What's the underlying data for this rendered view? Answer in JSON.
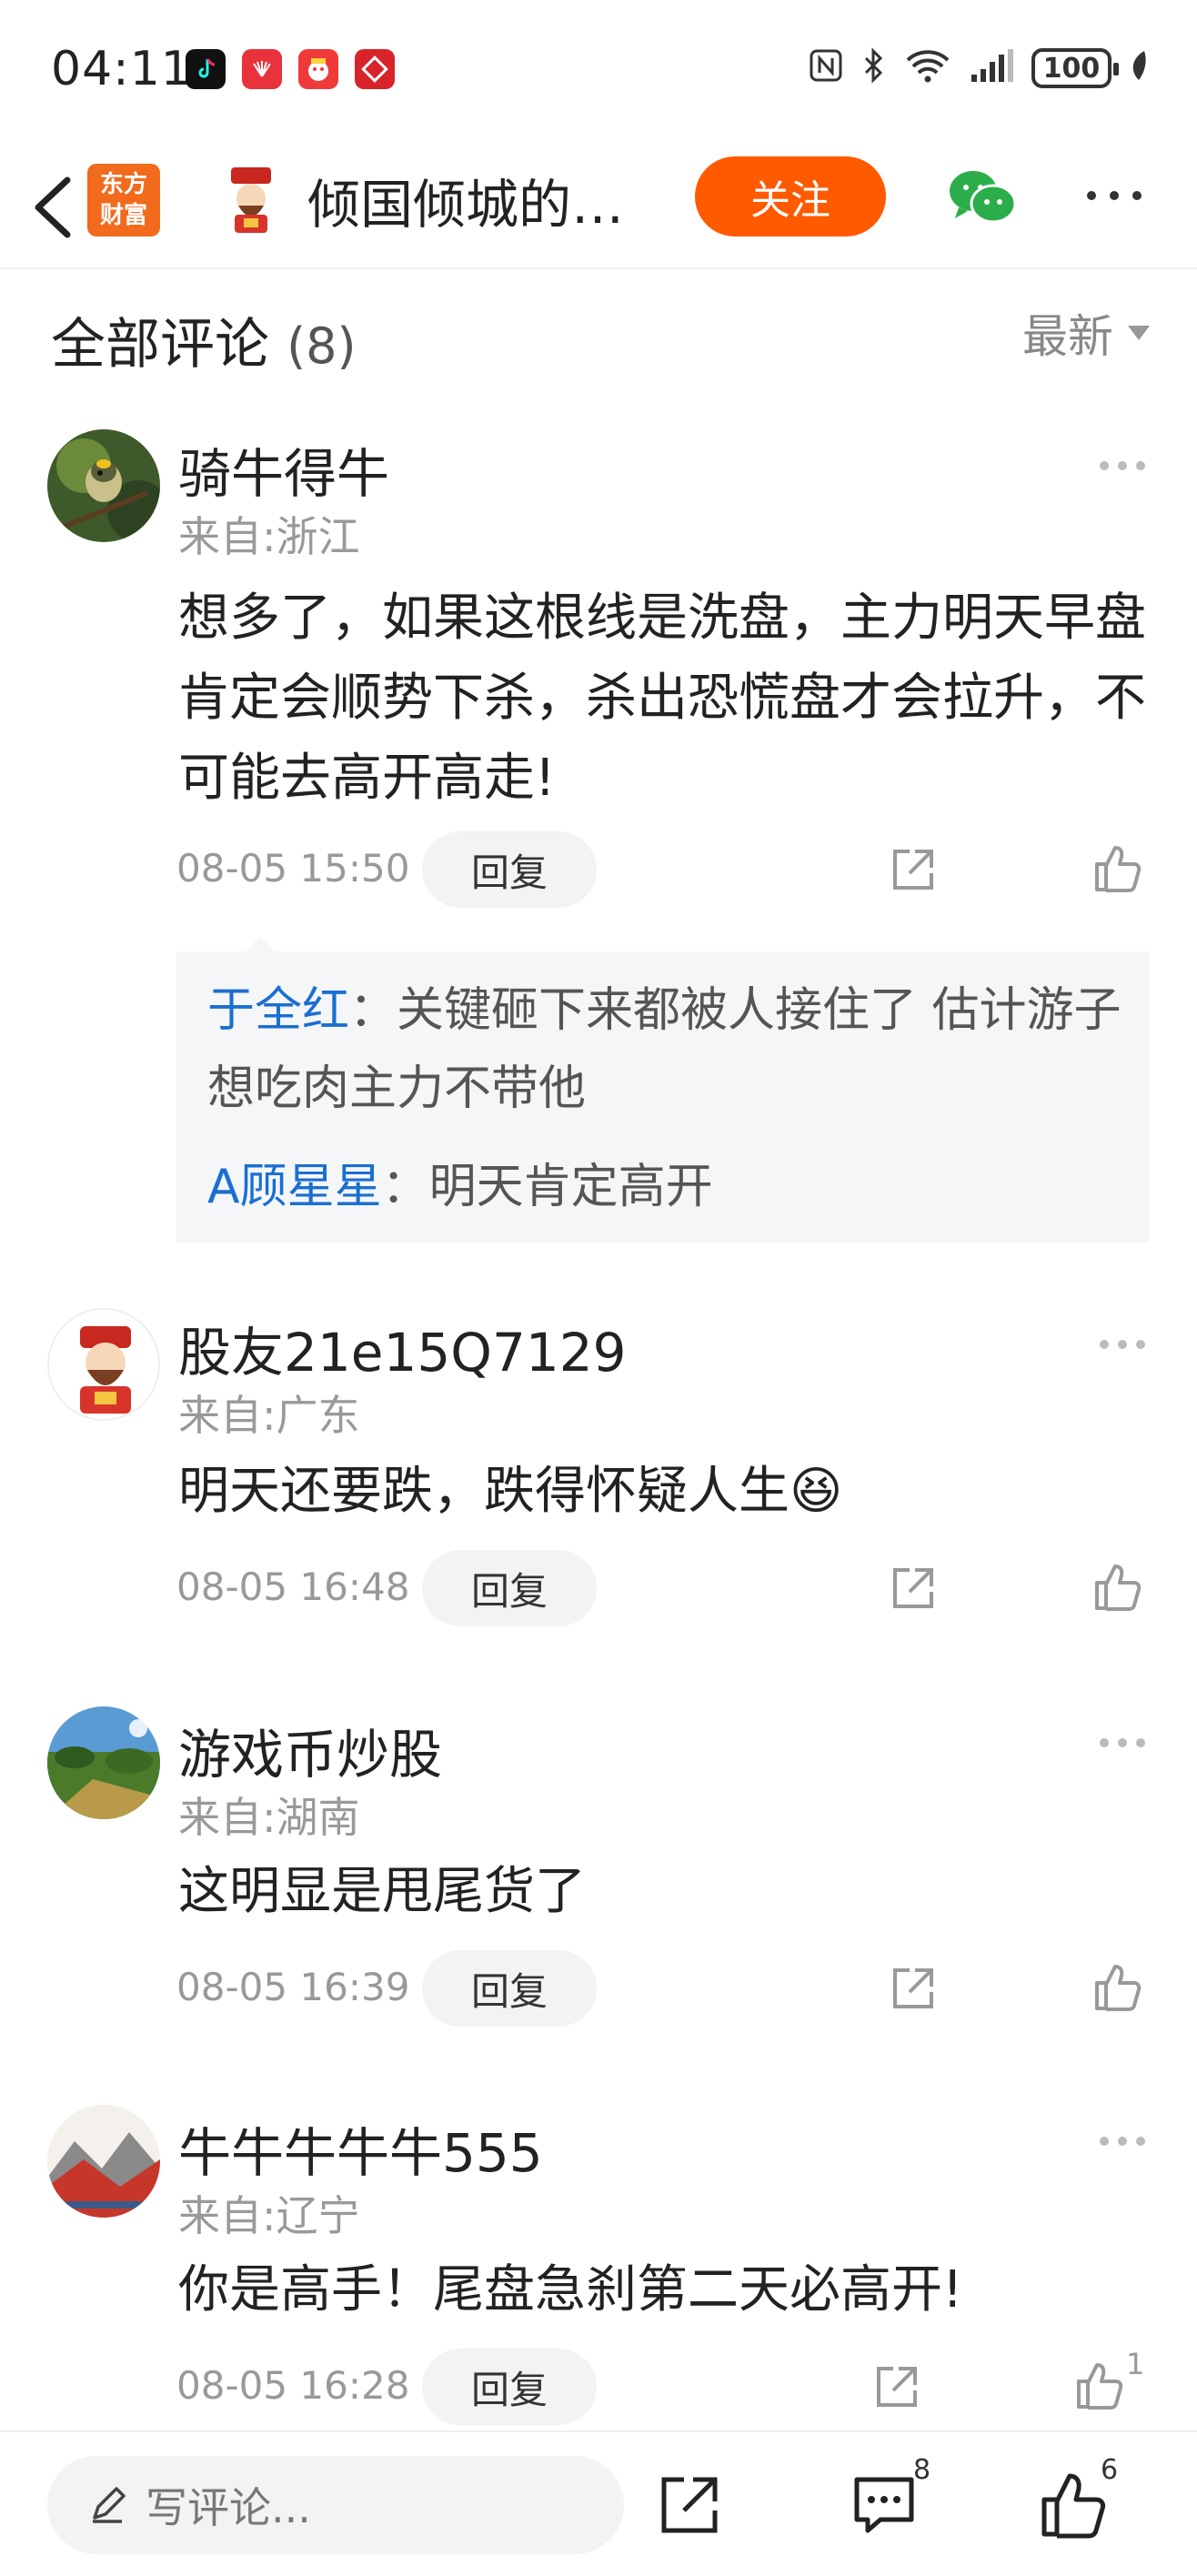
{
  "status_bar": {
    "time": "04:11",
    "battery": "100",
    "apps": [
      "tiktok-icon",
      "huawei-icon",
      "game-icon",
      "fund-icon"
    ]
  },
  "header": {
    "title": "倾国倾城的…",
    "logo_line1": "东方",
    "logo_line2": "财富",
    "follow_label": "关注"
  },
  "section": {
    "title": "全部评论",
    "count": "(8)",
    "sort_label": "最新"
  },
  "comments": [
    {
      "name": "骑牛得牛",
      "location": "来自:浙江",
      "text": "想多了，如果这根线是洗盘，主力明天早盘肯定会顺势下杀，杀出恐慌盘才会拉升，不可能去高开高走!",
      "time": "08-05 15:50",
      "reply_label": "回复",
      "replies": [
        {
          "name": "于全红",
          "text": "：关键砸下来都被人接住了  估计游子想吃肉主力不带他"
        },
        {
          "name": "A顾星星",
          "text": "：明天肯定高开"
        }
      ]
    },
    {
      "name": "股友21e15Q7129",
      "location": "来自:广东",
      "text": "明天还要跌，跌得怀疑人生",
      "emoji": "😆",
      "time": "08-05 16:48",
      "reply_label": "回复"
    },
    {
      "name": "游戏币炒股",
      "location": "来自:湖南",
      "text": "这明显是甩尾货了",
      "time": "08-05 16:39",
      "reply_label": "回复"
    },
    {
      "name": "牛牛牛牛牛555",
      "location": "来自:辽宁",
      "text": "你是高手！尾盘急刹第二天必高开!",
      "time": "08-05 16:28",
      "reply_label": "回复",
      "like_count": "1"
    }
  ],
  "bottom_bar": {
    "input_placeholder": "写评论...",
    "comment_count": "8",
    "like_count": "6"
  },
  "colors": {
    "accent": "#ff5a00",
    "link": "#1a6fd1",
    "muted": "#999999"
  }
}
